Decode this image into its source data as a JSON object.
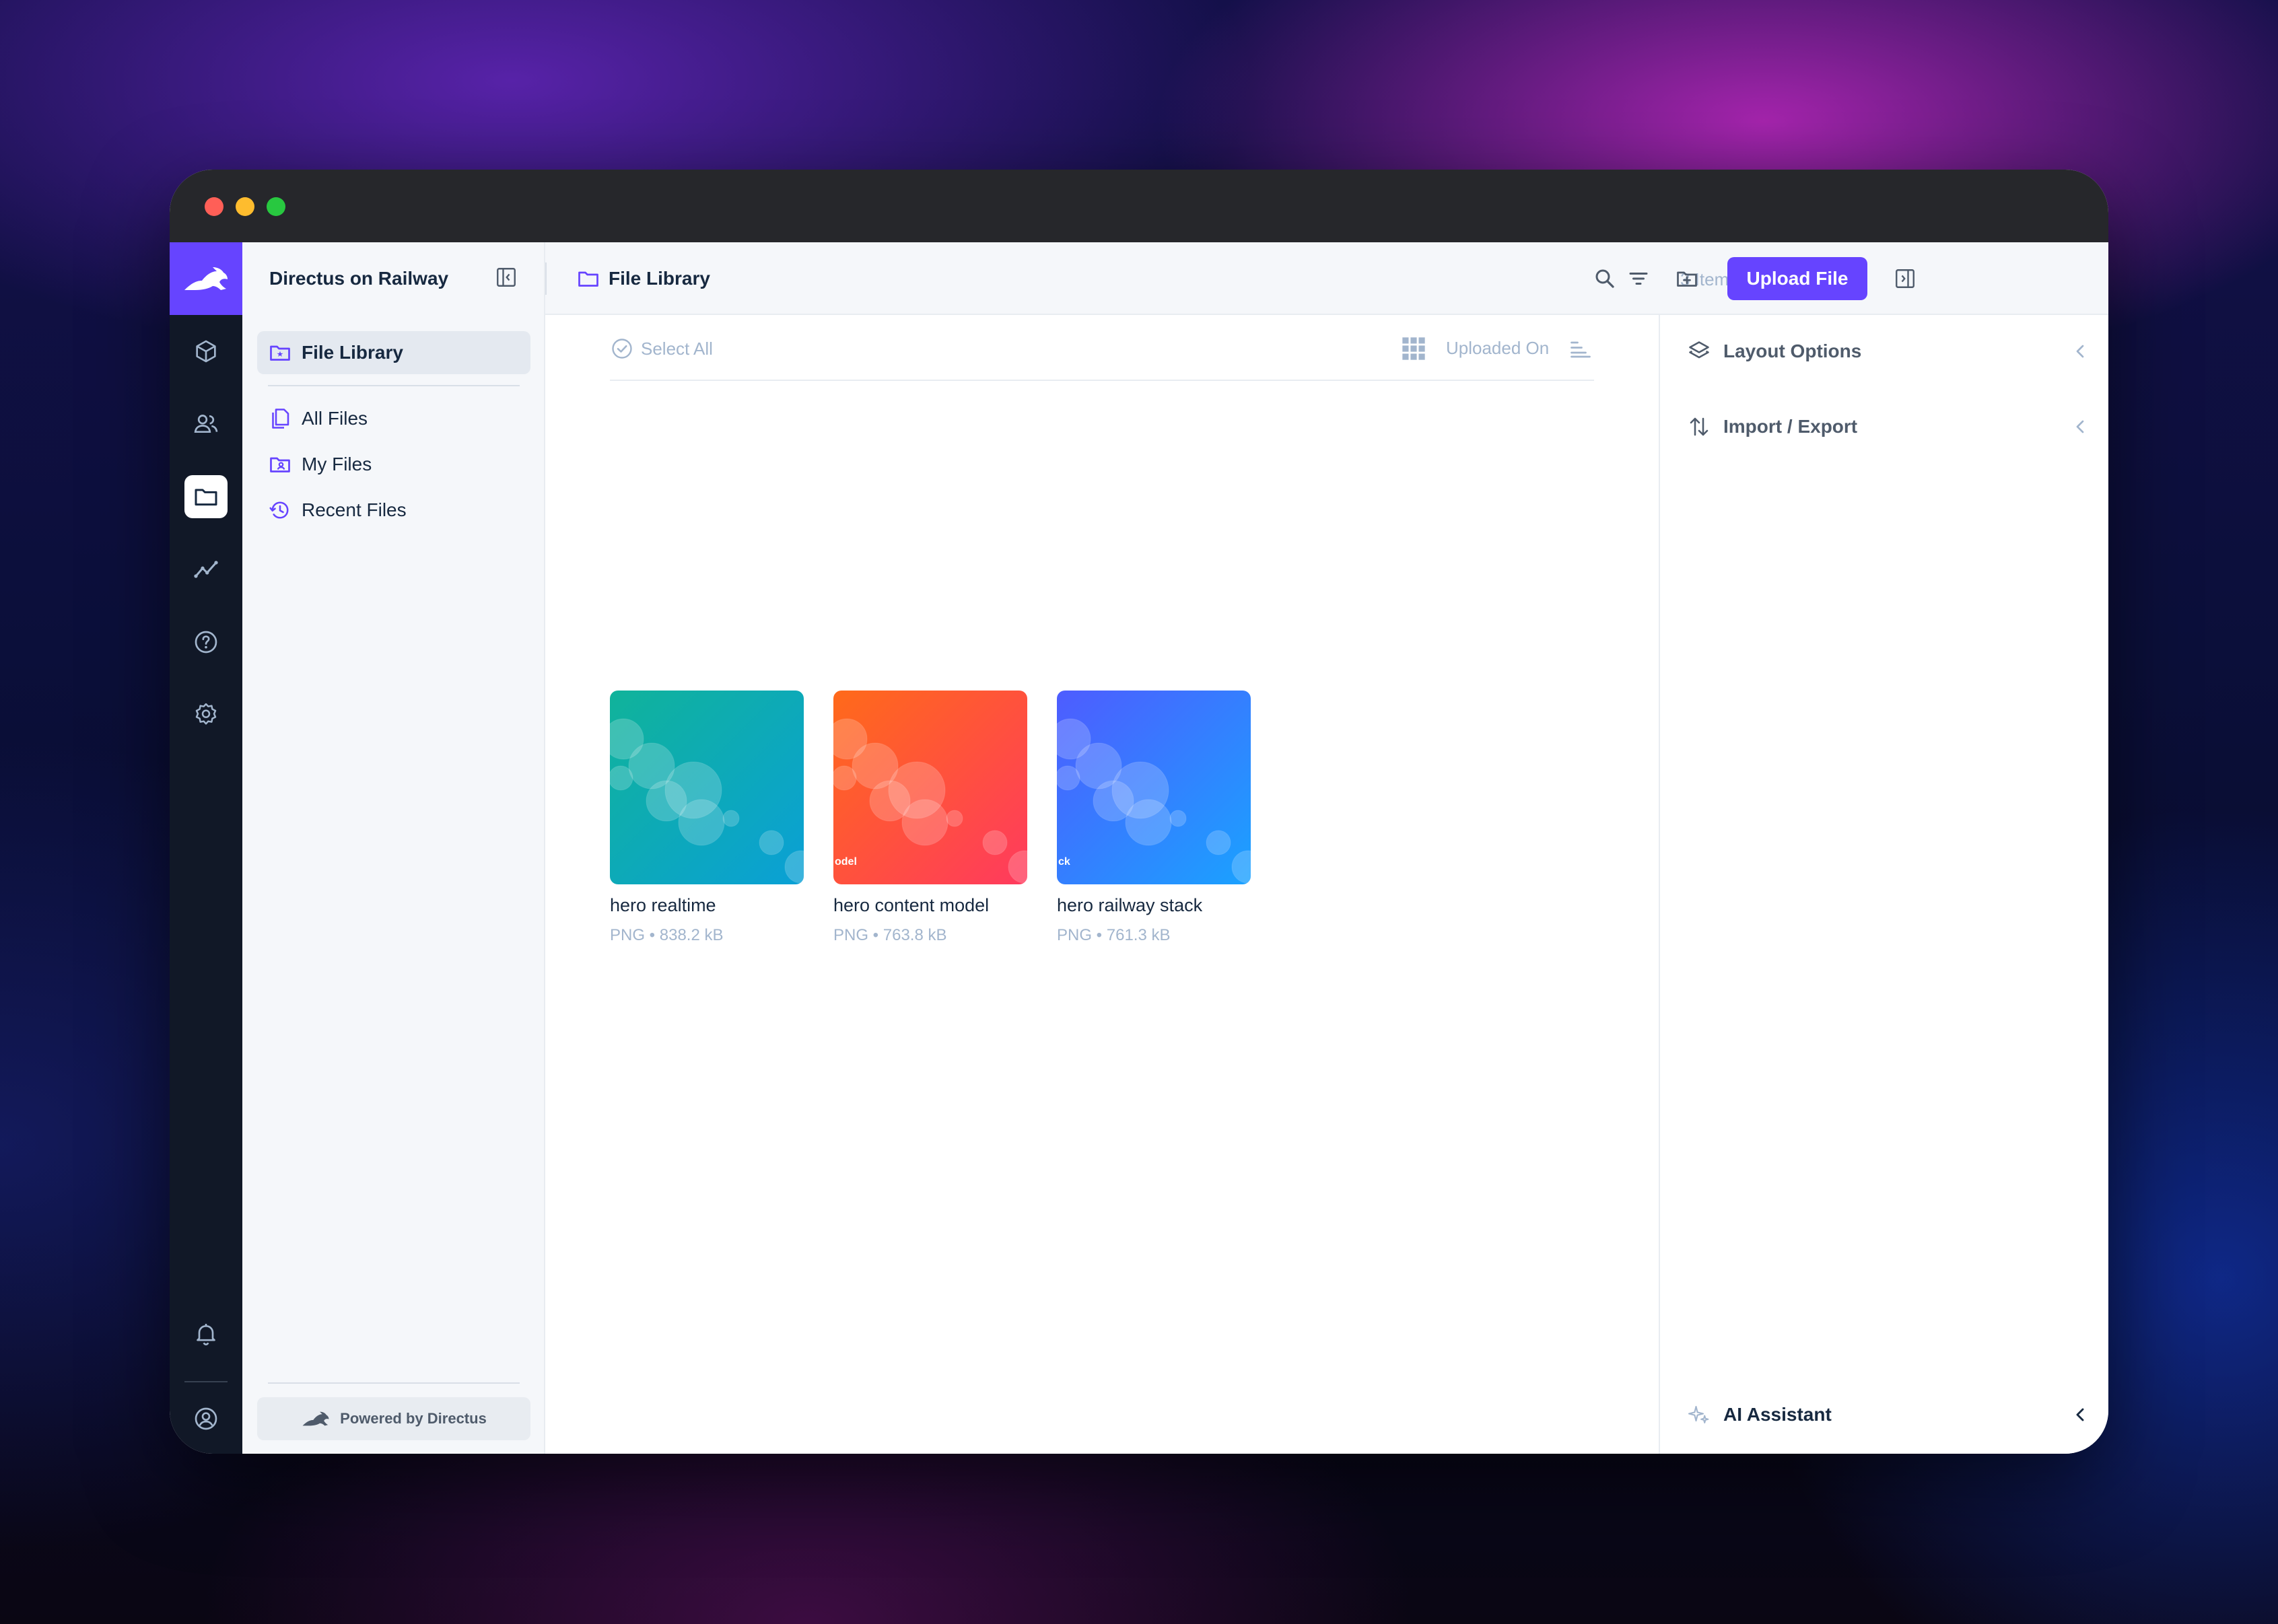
{
  "app": {
    "project_name": "Directus on Railway",
    "powered_by": "Powered by Directus"
  },
  "colors": {
    "accent": "#6644ff",
    "module_bar": "#111827",
    "text_primary": "#172940",
    "text_muted": "#a2b5cd"
  },
  "module_bar": {
    "icons": [
      "content-icon",
      "users-icon",
      "files-icon",
      "insights-icon",
      "help-icon",
      "settings-icon",
      "notifications-icon",
      "account-icon"
    ],
    "active": "files-icon"
  },
  "navigation": {
    "items": [
      {
        "label": "File Library",
        "icon": "folder-special-icon",
        "active": true
      },
      {
        "label": "All Files",
        "icon": "files-icon",
        "active": false
      },
      {
        "label": "My Files",
        "icon": "folder-user-icon",
        "active": false
      },
      {
        "label": "Recent Files",
        "icon": "history-icon",
        "active": false
      }
    ]
  },
  "header": {
    "title": "File Library",
    "item_count": "3 Items",
    "upload_label": "Upload File"
  },
  "toolbar": {
    "select_all": "Select All",
    "sort_field": "Uploaded On"
  },
  "files": [
    {
      "name": "hero realtime",
      "meta": "PNG • 838.2 kB",
      "tag": "",
      "gradient": [
        "#10b39a",
        "#0aa0d6"
      ]
    },
    {
      "name": "hero content model",
      "meta": "PNG • 763.8 kB",
      "tag": "odel",
      "gradient": [
        "#ff6a1a",
        "#ff3a5e"
      ]
    },
    {
      "name": "hero railway stack",
      "meta": "PNG • 761.3 kB",
      "tag": "ck",
      "gradient": [
        "#4e5cff",
        "#1aa2ff"
      ]
    }
  ],
  "sidebar": {
    "layout_options": "Layout Options",
    "import_export": "Import / Export",
    "ai_assistant": "AI Assistant"
  }
}
